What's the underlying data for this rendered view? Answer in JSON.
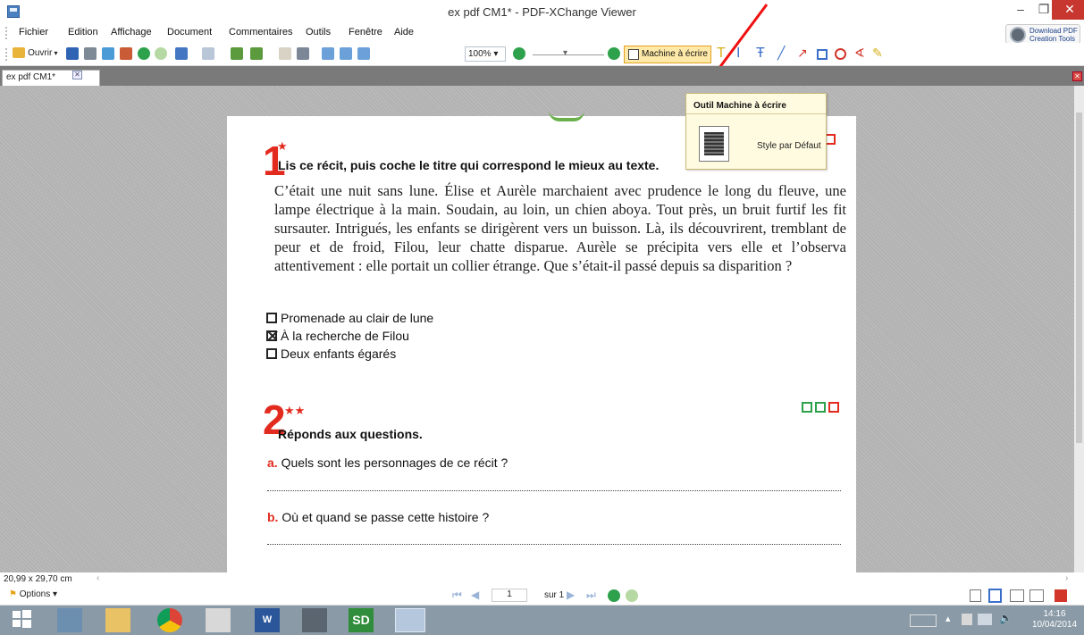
{
  "window": {
    "title": "ex pdf CM1* - PDF-XChange Viewer",
    "minimize": "–",
    "maximize": "❐",
    "close": "✕"
  },
  "menu": [
    "Fichier",
    "Edition",
    "Affichage",
    "Document",
    "Commentaires",
    "Outils",
    "Fenêtre",
    "Aide"
  ],
  "download_pdf": "Download PDF Creation Tools",
  "toolbar": {
    "open": "Ouvrir",
    "zoom": "100%",
    "typewriter": "Machine à écrire"
  },
  "tab": {
    "label": "ex pdf CM1*",
    "close": "✕"
  },
  "tooltip": {
    "title": "Outil Machine à écrire",
    "style": "Style par Défaut"
  },
  "document": {
    "ex1": {
      "number": "1",
      "stars": "★",
      "title": "Lis ce récit, puis coche le titre qui correspond le mieux au texte.",
      "text": "C’était une nuit sans lune. Élise et Aurèle marchaient avec prudence le long du fleuve, une lampe électrique à la main. Soudain, au loin, un chien aboya. Tout près, un bruit furtif les fit sursauter. Intrigués, les enfants se dirigèrent vers un buisson. Là, ils découvrirent, tremblant de peur et de froid, Filou, leur chatte disparue. Aurèle se précipita vers elle et l’observa attentivement : elle portait un collier étrange. Que s’était-il passé depuis sa disparition ?",
      "options": [
        {
          "label": "Promenade au clair de lune",
          "checked": false
        },
        {
          "label": "À la recherche de Filou",
          "checked": true
        },
        {
          "label": "Deux enfants égarés",
          "checked": false
        }
      ]
    },
    "ex2": {
      "number": "2",
      "stars": "★★",
      "title": "Réponds aux questions.",
      "qa_letter": "a.",
      "qa": "Quels sont les personnages de ce récit ?",
      "qb_letter": "b.",
      "qb": "Où et quand se passe cette histoire ?"
    }
  },
  "status": {
    "page_size": "20,99 x 29,70 cm"
  },
  "nav": {
    "options": "Options",
    "page": "1",
    "of": "sur 1"
  },
  "clock": {
    "time": "14:16",
    "date": "10/04/2014"
  },
  "colors": {
    "accent_red": "#e22b1e",
    "green": "#2da14b"
  }
}
